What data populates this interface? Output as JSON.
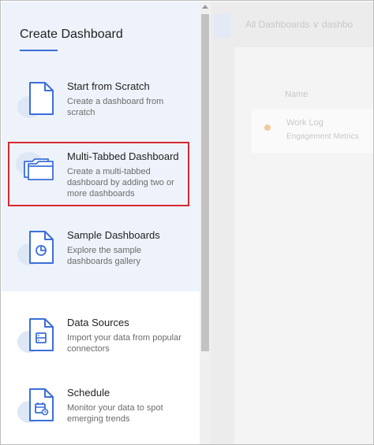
{
  "panel": {
    "title": "Create Dashboard",
    "items": [
      {
        "label": "Start from Scratch",
        "desc": "Create a dashboard from scratch",
        "icon": "blank-document-icon"
      },
      {
        "label": "Multi-Tabbed Dashboard",
        "desc": "Create a multi-tabbed dashboard by adding two or more dashboards",
        "icon": "folder-tabs-icon"
      },
      {
        "label": "Sample Dashboards",
        "desc": "Explore the sample dashboards gallery",
        "icon": "pie-chart-document-icon"
      },
      {
        "label": "Data Sources",
        "desc": "Import your data from popular connectors",
        "icon": "server-document-icon"
      },
      {
        "label": "Schedule",
        "desc": "Monitor your data to spot emerging trends",
        "icon": "calendar-document-icon"
      }
    ]
  },
  "colors": {
    "accent": "#3b6fd8",
    "highlight": "#d9282f",
    "panel_bg": "#eef3fb"
  },
  "background": {
    "header": "All Dashboards ∨ dashbo",
    "column": "Name",
    "row_title": "Work Log",
    "row_sub": "Engagement Metrics"
  }
}
